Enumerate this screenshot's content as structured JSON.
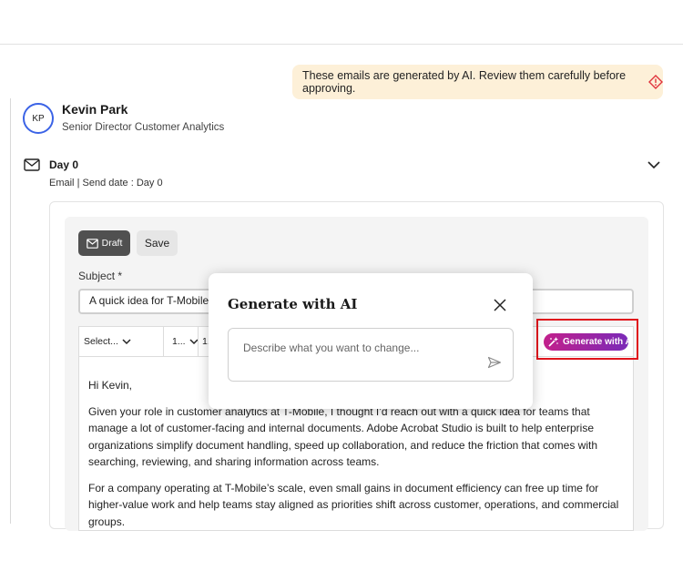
{
  "notice": {
    "text": "These emails are generated by AI. Review them carefully before approving."
  },
  "contact": {
    "initials": "KP",
    "name": "Kevin Park",
    "title": "Senior Director Customer Analytics"
  },
  "step": {
    "title": "Day 0",
    "channel": "Email",
    "separator": " | ",
    "send_date": "Send date : Day 0"
  },
  "editor": {
    "draft_label": "Draft",
    "save_label": "Save",
    "subject_label": "Subject",
    "required_mark": "*",
    "subject_value": "A quick idea for T-Mobile’s document workflows",
    "toolbar": {
      "style_select": "Select...",
      "font_select": "1...",
      "size_select": "1..."
    },
    "generate_label": "Generate with AI",
    "body": [
      "Hi Kevin,",
      "Given your role in customer analytics at T-Mobile, I thought I’d reach out with a quick idea for teams that manage a lot of customer-facing and internal documents. Adobe Acrobat Studio is built to help enterprise organizations simplify document handling, speed up collaboration, and reduce the friction that comes with searching, reviewing, and sharing information across teams.",
      "For a company operating at T-Mobile’s scale, even small gains in document efficiency can free up time for higher-value work and help teams stay aligned as priorities shift across customer, operations, and commercial groups."
    ]
  },
  "modal": {
    "title": "Generate with AI",
    "placeholder": "Describe what you want to change..."
  },
  "colors": {
    "notice_bg": "#fdf0d8",
    "avatar_ring": "#3b63e6",
    "highlight": "#e0141c",
    "gen_gradient_start": "#c2208b",
    "gen_gradient_end": "#7a2ab8"
  }
}
